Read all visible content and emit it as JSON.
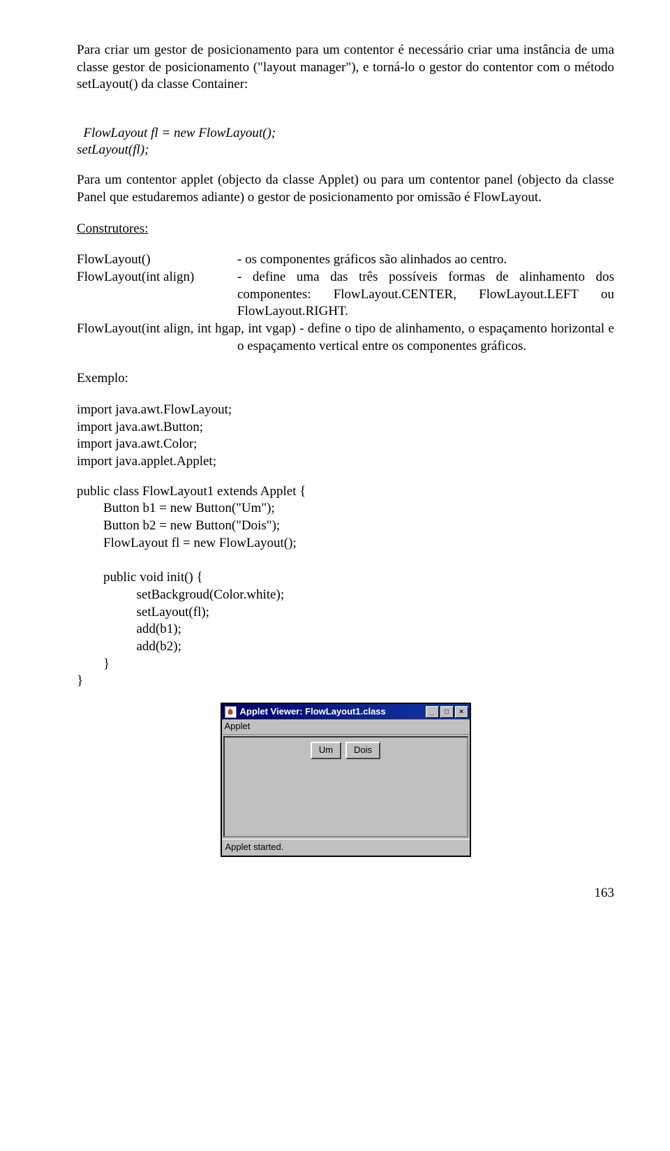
{
  "para1": "Para criar um gestor de posicionamento para um contentor é necessário criar uma instância de uma classe gestor de posicionamento (\"layout manager\"), e torná-lo o gestor do contentor com o método setLayout() da classe Container:",
  "code1_line1": "FlowLayout fl = new FlowLayout();",
  "code1_line2": "setLayout(fl);",
  "para2": "Para um contentor applet (objecto da classe Applet) ou para um contentor panel (objecto da classe Panel que estudaremos adiante) o gestor de posicionamento por omissão é FlowLayout.",
  "construtores_heading": "Construtores:",
  "fl_ctor0_name": "FlowLayout()",
  "fl_ctor0_desc": "- os componentes gráficos são alinhados ao centro.",
  "fl_ctor1_name": "FlowLayout(int align)",
  "fl_ctor1_desc": "- define uma das três possíveis formas de alinhamento dos componentes: FlowLayout.CENTER, FlowLayout.LEFT ou FlowLayout.RIGHT.",
  "fl_ctor2": "FlowLayout(int align, int hgap, int vgap) - define o tipo de alinhamento, o espaçamento horizontal e o espaçamento vertical entre os componentes gráficos.",
  "exemplo_heading": "Exemplo:",
  "imports": "import java.awt.FlowLayout;\nimport java.awt.Button;\nimport java.awt.Color;\nimport java.applet.Applet;",
  "class_code": "public class FlowLayout1 extends Applet {\n        Button b1 = new Button(\"Um\");\n        Button b2 = new Button(\"Dois\");\n        FlowLayout fl = new FlowLayout();\n\n        public void init() {\n                  setBackgroud(Color.white);\n                  setLayout(fl);\n                  add(b1);\n                  add(b2);\n        }\n}",
  "applet": {
    "title": "Applet Viewer: FlowLayout1.class",
    "menu": "Applet",
    "button1": "Um",
    "button2": "Dois",
    "status": "Applet started."
  },
  "page_number": "163"
}
